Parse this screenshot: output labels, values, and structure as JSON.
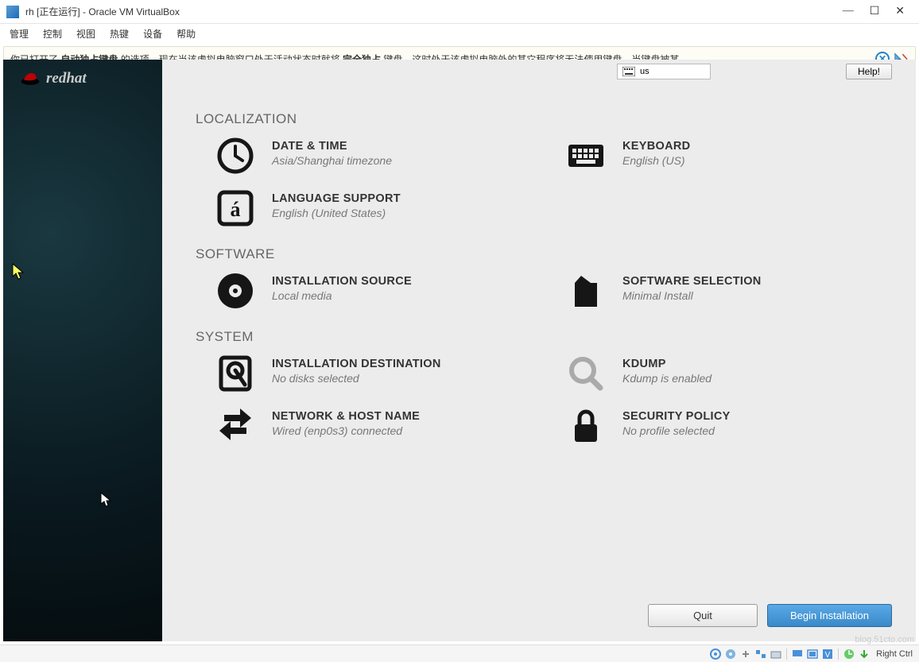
{
  "window": {
    "title": "rh [正在运行] - Oracle VM VirtualBox",
    "min": "—",
    "max": "☐",
    "close": "✕"
  },
  "menu": [
    "管理",
    "控制",
    "视图",
    "热键",
    "设备",
    "帮助"
  ],
  "notice": {
    "t1": "你已打开了 ",
    "b1": "自动独占键盘",
    "t2": " 的选项。现在当该虚拟电脑窗口处于活动状态时就将 ",
    "b2": "完全独占",
    "t3": " 键盘，这时处于该虚拟电脑外的其它程序将无法使用键盘。当键盘被某"
  },
  "sidebar": {
    "brand": "redhat"
  },
  "topbar": {
    "kb_layout": "us",
    "help": "Help!"
  },
  "sections": {
    "localization": {
      "header": "LOCALIZATION",
      "date_time": {
        "title": "DATE & TIME",
        "sub": "Asia/Shanghai timezone"
      },
      "keyboard": {
        "title": "KEYBOARD",
        "sub": "English (US)"
      },
      "language": {
        "title": "LANGUAGE SUPPORT",
        "sub": "English (United States)"
      }
    },
    "software": {
      "header": "SOFTWARE",
      "source": {
        "title": "INSTALLATION SOURCE",
        "sub": "Local media"
      },
      "selection": {
        "title": "SOFTWARE SELECTION",
        "sub": "Minimal Install"
      }
    },
    "system": {
      "header": "SYSTEM",
      "dest": {
        "title": "INSTALLATION DESTINATION",
        "sub": "No disks selected"
      },
      "kdump": {
        "title": "KDUMP",
        "sub": "Kdump is enabled"
      },
      "network": {
        "title": "NETWORK & HOST NAME",
        "sub": "Wired (enp0s3) connected"
      },
      "security": {
        "title": "SECURITY POLICY",
        "sub": "No profile selected"
      }
    }
  },
  "buttons": {
    "quit": "Quit",
    "begin": "Begin Installation"
  },
  "statusbar": {
    "host_key": "Right Ctrl"
  },
  "watermark": "blog.51cto.com"
}
